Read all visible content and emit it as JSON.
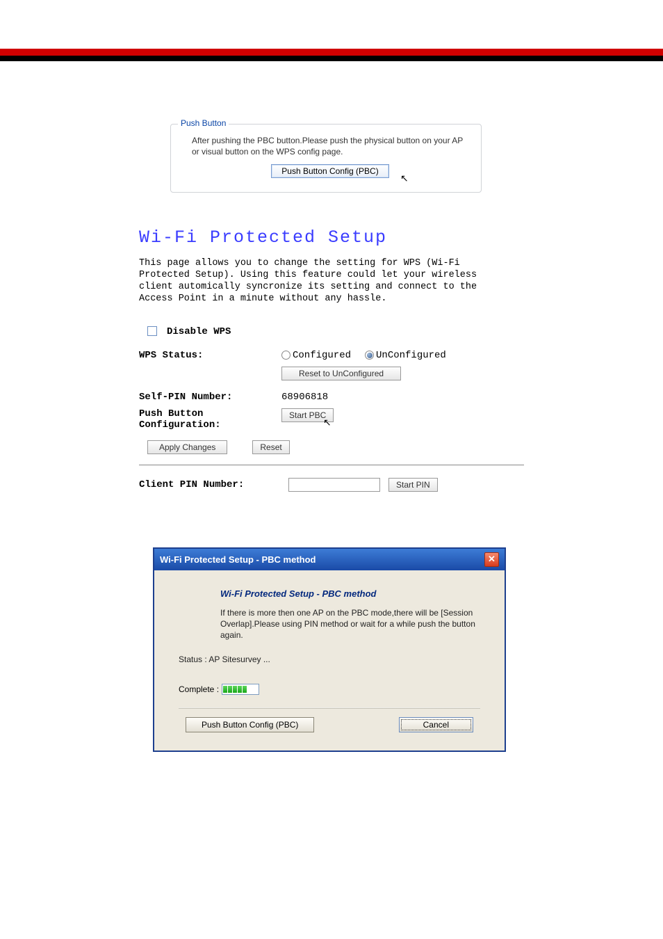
{
  "pushButtonBox": {
    "legend": "Push Button",
    "desc": "After pushing the PBC button.Please push the physical button on your AP or visual button on the WPS config page.",
    "btn": "Push Button Config (PBC)"
  },
  "wpsPage": {
    "title": "Wi-Fi Protected Setup",
    "desc": "This page allows you to change the setting for WPS (Wi-Fi Protected Setup). Using this feature could let your wireless client automically syncronize its setting and connect to the Access Point in a minute without any hassle.",
    "disableWps": "Disable WPS",
    "statusLabel": "WPS Status:",
    "statusConfigured": "Configured",
    "statusUnconfigured": "UnConfigured",
    "resetToUnconf": "Reset to UnConfigured",
    "selfPinLabel": "Self-PIN Number:",
    "selfPinValue": "68906818",
    "pbcLabel": "Push Button Configuration:",
    "startPbc": "Start PBC",
    "applyChanges": "Apply Changes",
    "reset": "Reset",
    "clientPinLabel": "Client PIN Number:",
    "startPin": "Start PIN"
  },
  "dialog": {
    "title": "Wi-Fi Protected Setup - PBC method",
    "heading": "Wi-Fi Protected Setup - PBC method",
    "body": "If there is more then one AP on the PBC mode,there will be [Session Overlap].Please using PIN method or wait for a while push the button again.",
    "status": "Status : AP Sitesurvey ...",
    "completeLabel": "Complete :",
    "btnPbc": "Push Button Config (PBC)",
    "btnCancel": "Cancel"
  }
}
